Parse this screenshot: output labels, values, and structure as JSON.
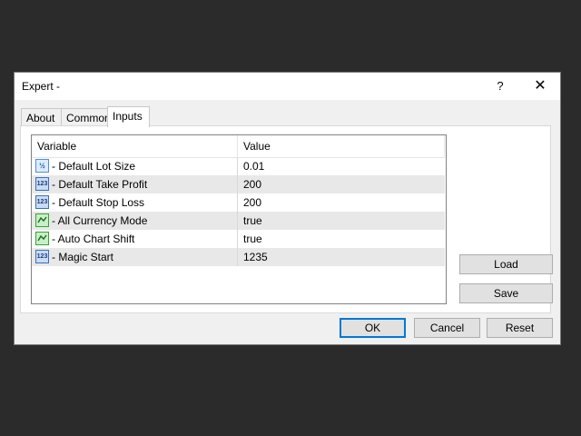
{
  "window": {
    "title": "Expert -",
    "help_label": "?",
    "close_label": "✕"
  },
  "tabs": [
    {
      "label": "About"
    },
    {
      "label": "Common"
    },
    {
      "label": "Inputs"
    }
  ],
  "active_tab": "Inputs",
  "table": {
    "columns": [
      "Variable",
      "Value"
    ],
    "rows": [
      {
        "icon": "fraction-icon",
        "variable": " - Default Lot Size",
        "value": "0.01"
      },
      {
        "icon": "number-icon",
        "variable": " - Default Take Profit",
        "value": "200"
      },
      {
        "icon": "number-icon",
        "variable": " - Default Stop Loss",
        "value": "200"
      },
      {
        "icon": "boolean-icon",
        "variable": " - All Currency Mode",
        "value": "true"
      },
      {
        "icon": "boolean-icon",
        "variable": " - Auto Chart Shift",
        "value": "true"
      },
      {
        "icon": "number-icon",
        "variable": " - Magic Start",
        "value": "1235"
      }
    ]
  },
  "side_buttons": {
    "load_label": "Load",
    "save_label": "Save"
  },
  "footer_buttons": {
    "ok_label": "OK",
    "cancel_label": "Cancel",
    "reset_label": "Reset"
  },
  "icon_glyphs": {
    "fraction": "½",
    "number": "123"
  },
  "colors": {
    "accent": "#0078d7",
    "alt_row": "#e8e8e8",
    "background": "#2b2b2b"
  }
}
